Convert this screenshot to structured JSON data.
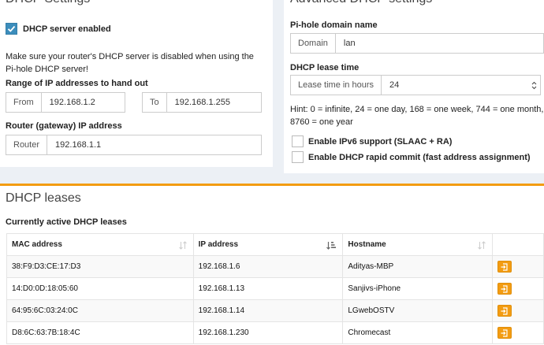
{
  "dhcp_settings": {
    "title": "DHCP Settings",
    "server_enabled_label": "DHCP server enabled",
    "server_enabled_checked": true,
    "warning_text": "Make sure your router's DHCP server is disabled when using the Pi-hole DHCP server!",
    "range_label": "Range of IP addresses to hand out",
    "from_label": "From",
    "from_value": "192.168.1.2",
    "to_label": "To",
    "to_value": "192.168.1.255",
    "router_section_label": "Router (gateway) IP address",
    "router_label": "Router",
    "router_value": "192.168.1.1"
  },
  "advanced": {
    "title": "Advanced DHCP settings",
    "domain_section_label": "Pi-hole domain name",
    "domain_label": "Domain",
    "domain_value": "lan",
    "lease_section_label": "DHCP lease time",
    "lease_label": "Lease time in hours",
    "lease_value": "24",
    "hint": "Hint: 0 = infinite, 24 = one day, 168 = one week, 744 = one month, 8760 = one year",
    "ipv6_label": "Enable IPv6 support (SLAAC + RA)",
    "rapid_label": "Enable DHCP rapid commit (fast address assignment)"
  },
  "leases": {
    "title": "DHCP leases",
    "subtitle": "Currently active DHCP leases",
    "columns": [
      "MAC address",
      "IP address",
      "Hostname"
    ],
    "rows": [
      {
        "mac": "38:F9:D3:CE:17:D3",
        "ip": "192.168.1.6",
        "host": "Adityas-MBP"
      },
      {
        "mac": "14:D0:0D:18:05:60",
        "ip": "192.168.1.13",
        "host": "Sanjivs-iPhone"
      },
      {
        "mac": "64:95:6C:03:24:0C",
        "ip": "192.168.1.14",
        "host": "LGwebOSTV"
      },
      {
        "mac": "D8:6C:63:7B:18:4C",
        "ip": "192.168.1.230",
        "host": "Chromecast"
      }
    ]
  },
  "colors": {
    "accent": "#3c8dbc",
    "warning": "#f39c12"
  }
}
